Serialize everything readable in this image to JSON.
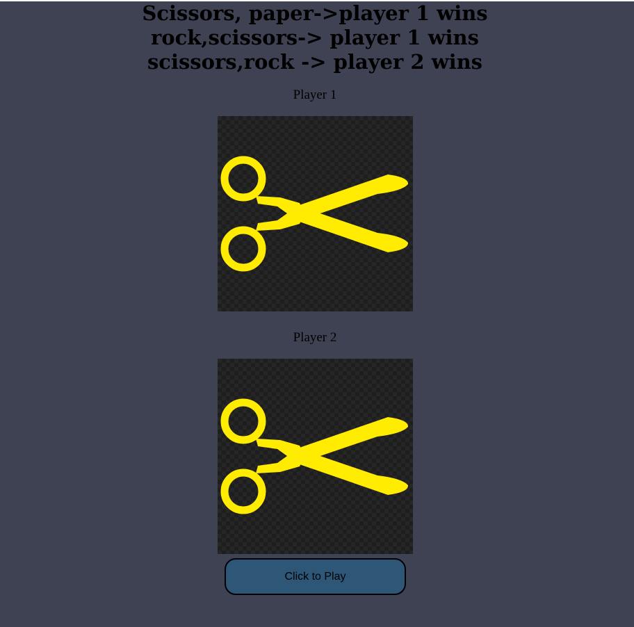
{
  "rules": {
    "lines": [
      "Scissors, paper->player 1 wins",
      "rock,scissors-> player 1 wins",
      "scissors,rock -> player 2 wins"
    ]
  },
  "player1": {
    "label": "Player 1",
    "choice": "scissors",
    "icon": "scissors-icon"
  },
  "player2": {
    "label": "Player 2",
    "choice": "scissors",
    "icon": "scissors-icon"
  },
  "play_button": {
    "label": "Click to Play"
  },
  "colors": {
    "background": "#3f4253",
    "card_background": "#1e1e1e",
    "scissors": "#ffec00",
    "button": "#2e5677"
  }
}
